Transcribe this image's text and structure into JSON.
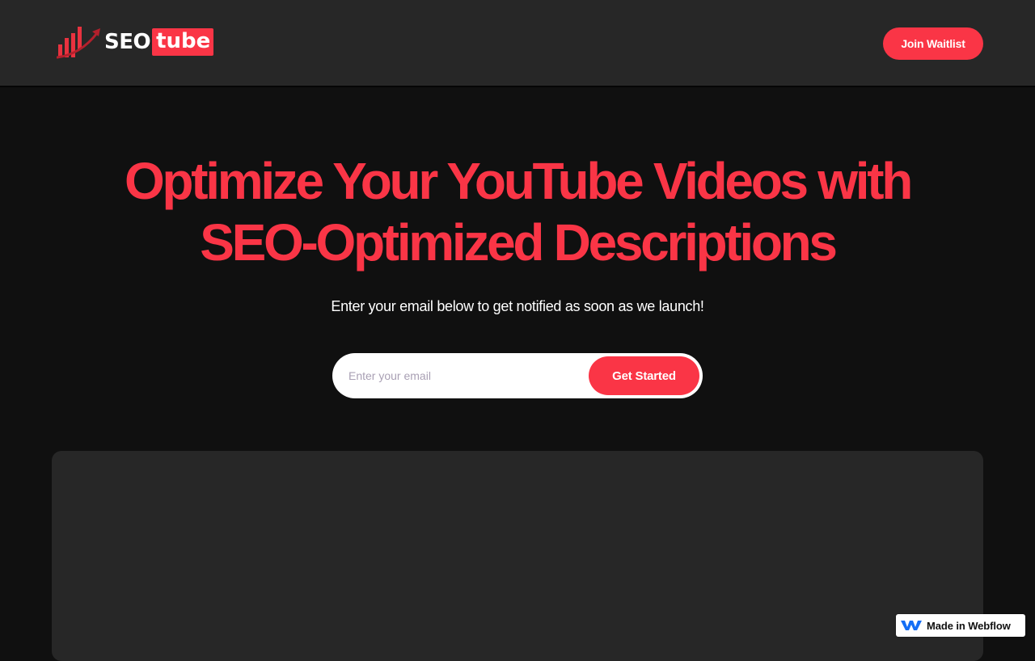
{
  "brand": {
    "name_part1": "SEO",
    "name_part2": "tube",
    "logo_icon": "bar-chart-arrow-icon",
    "accent_color": "#fa3546"
  },
  "nav": {
    "cta_label": "Join Waitlist"
  },
  "hero": {
    "title_line1": "Optimize Your YouTube Videos with",
    "title_line2": "SEO-Optimized Descriptions",
    "subtitle": "Enter your email below to get notified as soon as we launch!"
  },
  "signup": {
    "email_placeholder": "Enter your email",
    "email_value": "",
    "submit_label": "Get Started"
  },
  "badge": {
    "icon": "webflow-logo-icon",
    "label": "Made in Webflow"
  },
  "colors": {
    "page_bg": "#101010",
    "nav_bg": "#272727",
    "panel_bg": "#272727",
    "text": "#ffffff"
  }
}
